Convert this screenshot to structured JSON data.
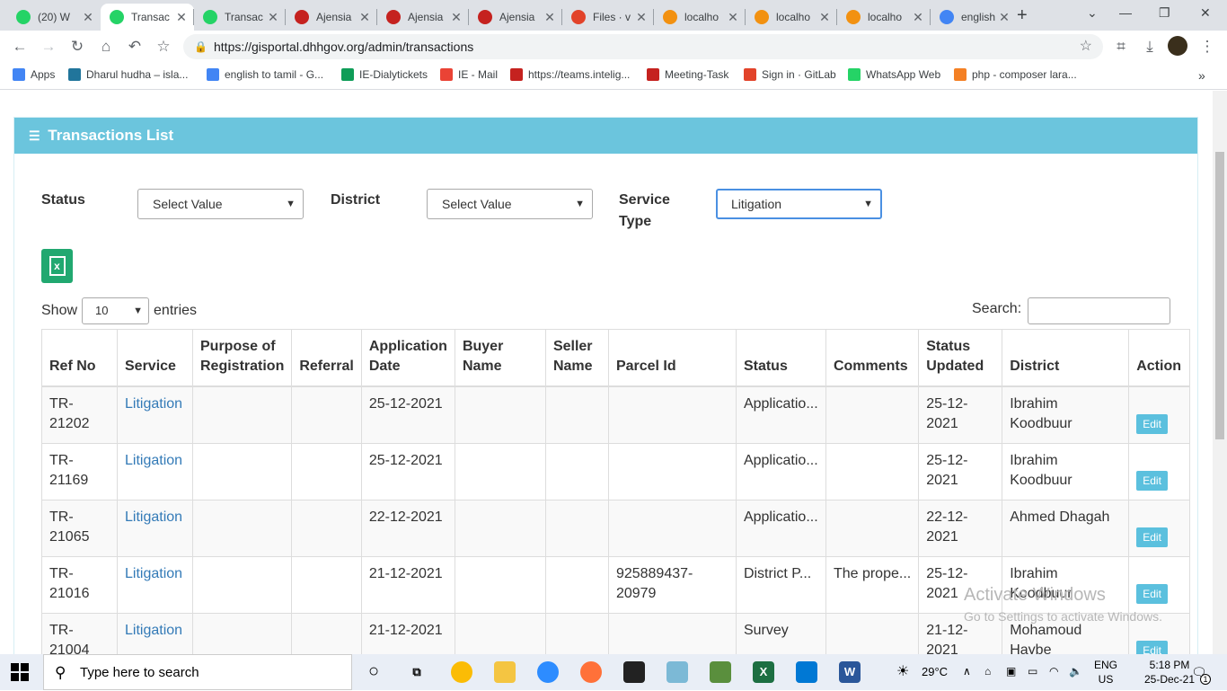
{
  "browser": {
    "tabs": [
      {
        "title": "(20) W",
        "favicon_color": "#25d366",
        "active": false
      },
      {
        "title": "Transac",
        "favicon_color": "#25d366",
        "active": true
      },
      {
        "title": "Transac",
        "favicon_color": "#25d366",
        "active": false
      },
      {
        "title": "Ajensia",
        "favicon_color": "#c5221f",
        "active": false
      },
      {
        "title": "Ajensia",
        "favicon_color": "#c5221f",
        "active": false
      },
      {
        "title": "Ajensia",
        "favicon_color": "#c5221f",
        "active": false
      },
      {
        "title": "Files · v",
        "favicon_color": "#e2432a",
        "active": false
      },
      {
        "title": "localho",
        "favicon_color": "#f29111",
        "active": false
      },
      {
        "title": "localho",
        "favicon_color": "#f29111",
        "active": false
      },
      {
        "title": "localho",
        "favicon_color": "#f29111",
        "active": false
      },
      {
        "title": "english",
        "favicon_color": "#4285f4",
        "active": false
      }
    ],
    "url": "https://gisportal.dhhgov.org/admin/transactions",
    "bookmarks": [
      {
        "label": "Apps",
        "color": "#4285f4"
      },
      {
        "label": "Dharul hudha – isla...",
        "color": "#21759b"
      },
      {
        "label": "english to tamil - G...",
        "color": "#4285f4"
      },
      {
        "label": "IE-Dialytickets",
        "color": "#0f9d58"
      },
      {
        "label": "IE - Mail",
        "color": "#ea4335"
      },
      {
        "label": "https://teams.intelig...",
        "color": "#c5221f"
      },
      {
        "label": "Meeting-Task",
        "color": "#c5221f"
      },
      {
        "label": "Sign in · GitLab",
        "color": "#e2432a"
      },
      {
        "label": "WhatsApp Web",
        "color": "#25d366"
      },
      {
        "label": "php - composer lara...",
        "color": "#f48024"
      }
    ]
  },
  "panel": {
    "title": "Transactions List",
    "filters": {
      "status_label": "Status",
      "status_value": "Select Value",
      "district_label": "District",
      "district_value": "Select Value",
      "service_type_label_line1": "Service",
      "service_type_label_line2": "Type",
      "service_type_value": "Litigation"
    },
    "export_icon": "excel-icon",
    "show_label": "Show",
    "entries_value": "10",
    "entries_label": "entries",
    "search_label": "Search:",
    "columns": [
      "Ref No",
      "Service",
      "Purpose of Registration",
      "Referral",
      "Application Date",
      "Buyer Name",
      "Seller Name",
      "Parcel Id",
      "Status",
      "Comments",
      "Status Updated",
      "District",
      "Action"
    ],
    "rows": [
      {
        "ref": "TR-21202",
        "service": "Litigation",
        "purpose": "",
        "referral": "",
        "app_date": "25-12-2021",
        "buyer": "",
        "seller": "",
        "parcel": "",
        "status": "Applicatio...",
        "comments": "",
        "updated": "25-12-2021",
        "district": "Ibrahim Koodbuur",
        "action": "Edit"
      },
      {
        "ref": "TR-21169",
        "service": "Litigation",
        "purpose": "",
        "referral": "",
        "app_date": "25-12-2021",
        "buyer": "",
        "seller": "",
        "parcel": "",
        "status": "Applicatio...",
        "comments": "",
        "updated": "25-12-2021",
        "district": "Ibrahim Koodbuur",
        "action": "Edit"
      },
      {
        "ref": "TR-21065",
        "service": "Litigation",
        "purpose": "",
        "referral": "",
        "app_date": "22-12-2021",
        "buyer": "",
        "seller": "",
        "parcel": "",
        "status": "Applicatio...",
        "comments": "",
        "updated": "22-12-2021",
        "district": "Ahmed Dhagah",
        "action": "Edit"
      },
      {
        "ref": "TR-21016",
        "service": "Litigation",
        "purpose": "",
        "referral": "",
        "app_date": "21-12-2021",
        "buyer": "",
        "seller": "",
        "parcel": "925889437-20979",
        "status": "District P...",
        "comments": "The prope...",
        "updated": "25-12-2021",
        "district": "Ibrahim Koodbuur",
        "action": "Edit"
      },
      {
        "ref": "TR-21004",
        "service": "Litigation",
        "purpose": "",
        "referral": "",
        "app_date": "21-12-2021",
        "buyer": "",
        "seller": "",
        "parcel": "",
        "status": "Survey",
        "comments": "",
        "updated": "21-12-2021",
        "district": "Mohamoud Haybe",
        "action": "Edit"
      }
    ]
  },
  "watermark": {
    "line1": "Activate Windows",
    "line2": "Go to Settings to activate Windows."
  },
  "taskbar": {
    "search_placeholder": "Type here to search",
    "weather": "29°C",
    "lang_line1": "ENG",
    "lang_line2": "US",
    "time": "5:18 PM",
    "date": "25-Dec-21",
    "notification_count": "1"
  }
}
